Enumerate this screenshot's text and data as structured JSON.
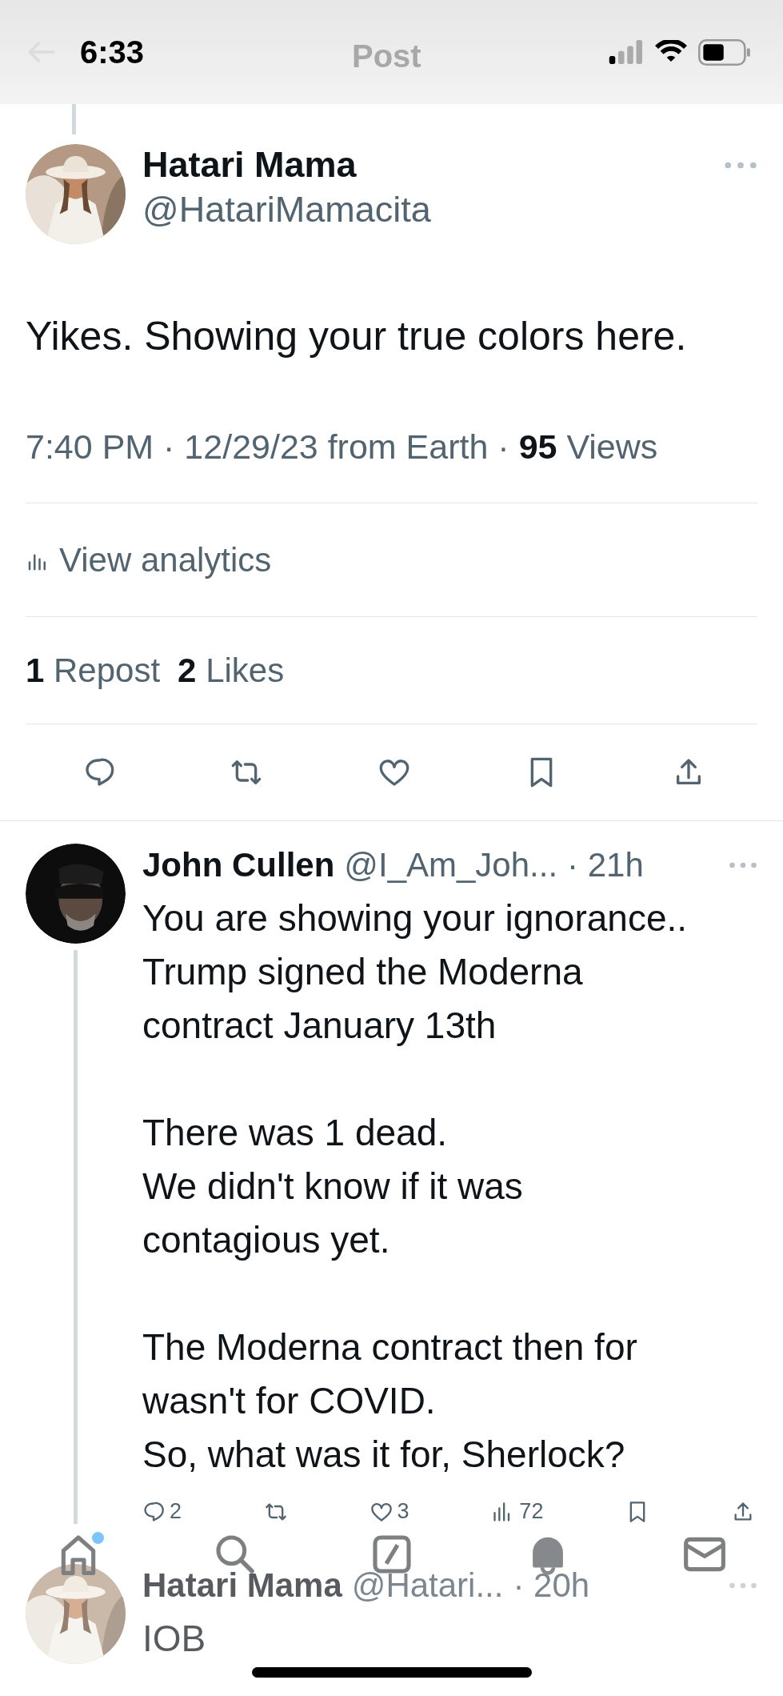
{
  "status_bar": {
    "time": "6:33"
  },
  "header": {
    "title": "Post"
  },
  "tweet": {
    "author": {
      "name": "Hatari Mama",
      "handle": "@HatariMamacita"
    },
    "text": "Yikes. Showing your true colors here.",
    "meta": "7:40 PM · 12/29/23 from Earth · **95** Views",
    "analytics": "View analytics",
    "stats": [
      {
        "count": "1",
        "label": "Repost"
      },
      {
        "count": "2",
        "label": "Likes"
      }
    ]
  },
  "replies": [
    {
      "name": "John Cullen",
      "handle": "@I_Am_Joh...",
      "age": "· 21h",
      "text": "You are showing your ignorance..\nTrump signed the Moderna contract January 13th\n\nThere was 1 dead.\nWe didn't know if it was contagious yet.\n\nThe Moderna contract then for wasn't for COVID.\nSo, what was it for, Sherlock?",
      "actions": {
        "replies": "2",
        "likes": "3",
        "views": "72"
      }
    },
    {
      "name": "Hatari Mama",
      "handle": "@Hatari...",
      "age": "· 20h",
      "text": "IOB"
    }
  ],
  "tab_bar": {
    "items": [
      {
        "kind": "home",
        "selected": false,
        "badge": true
      },
      {
        "kind": "search",
        "selected": false,
        "badge": false
      },
      {
        "kind": "grok",
        "selected": false,
        "badge": false
      },
      {
        "kind": "notifications",
        "selected": true,
        "badge": false
      },
      {
        "kind": "messages",
        "selected": false,
        "badge": false
      }
    ]
  }
}
